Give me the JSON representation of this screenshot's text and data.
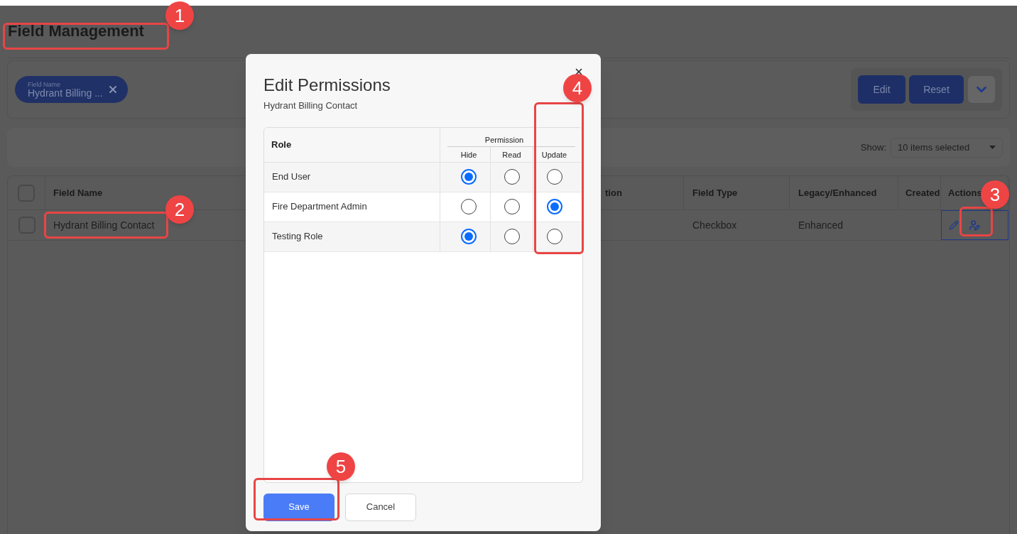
{
  "page": {
    "title": "Field Management"
  },
  "filter": {
    "chip": {
      "label": "Field Name",
      "value": "Hydrant Billing ..."
    },
    "buttons": [
      "Edit",
      "Reset"
    ]
  },
  "toolbar": {
    "show_label": "Show:",
    "show_value": "10 items selected"
  },
  "table": {
    "all_checked": false,
    "columns": [
      "Field Name",
      "tion",
      "Field Type",
      "Legacy/Enhanced",
      "Created",
      "Actions"
    ],
    "rows": [
      {
        "checked": false,
        "cells": [
          "Hydrant Billing Contact",
          "",
          "Checkbox",
          "Enhanced",
          ""
        ]
      }
    ]
  },
  "dialog": {
    "title": "Edit Permissions",
    "subtitle": "Hydrant Billing Contact",
    "role_header": "Role",
    "permission_header": "Permission",
    "permission_columns": [
      "Hide",
      "Read",
      "Update"
    ],
    "rows": [
      {
        "role": "End User",
        "options": [
          {
            "selected": true
          },
          {
            "selected": false
          },
          {
            "selected": false
          }
        ]
      },
      {
        "role": "Fire Department Admin",
        "options": [
          {
            "selected": false
          },
          {
            "selected": false
          },
          {
            "selected": true
          }
        ]
      },
      {
        "role": "Testing Role",
        "options": [
          {
            "selected": true
          },
          {
            "selected": false
          },
          {
            "selected": false
          }
        ]
      }
    ],
    "buttons": [
      {
        "label": "Save",
        "kind": "primary"
      },
      {
        "label": "Cancel",
        "kind": "secondary"
      }
    ]
  },
  "annotations": [
    {
      "label": "1"
    },
    {
      "label": "2"
    },
    {
      "label": "3"
    },
    {
      "label": "4"
    },
    {
      "label": "5"
    }
  ]
}
